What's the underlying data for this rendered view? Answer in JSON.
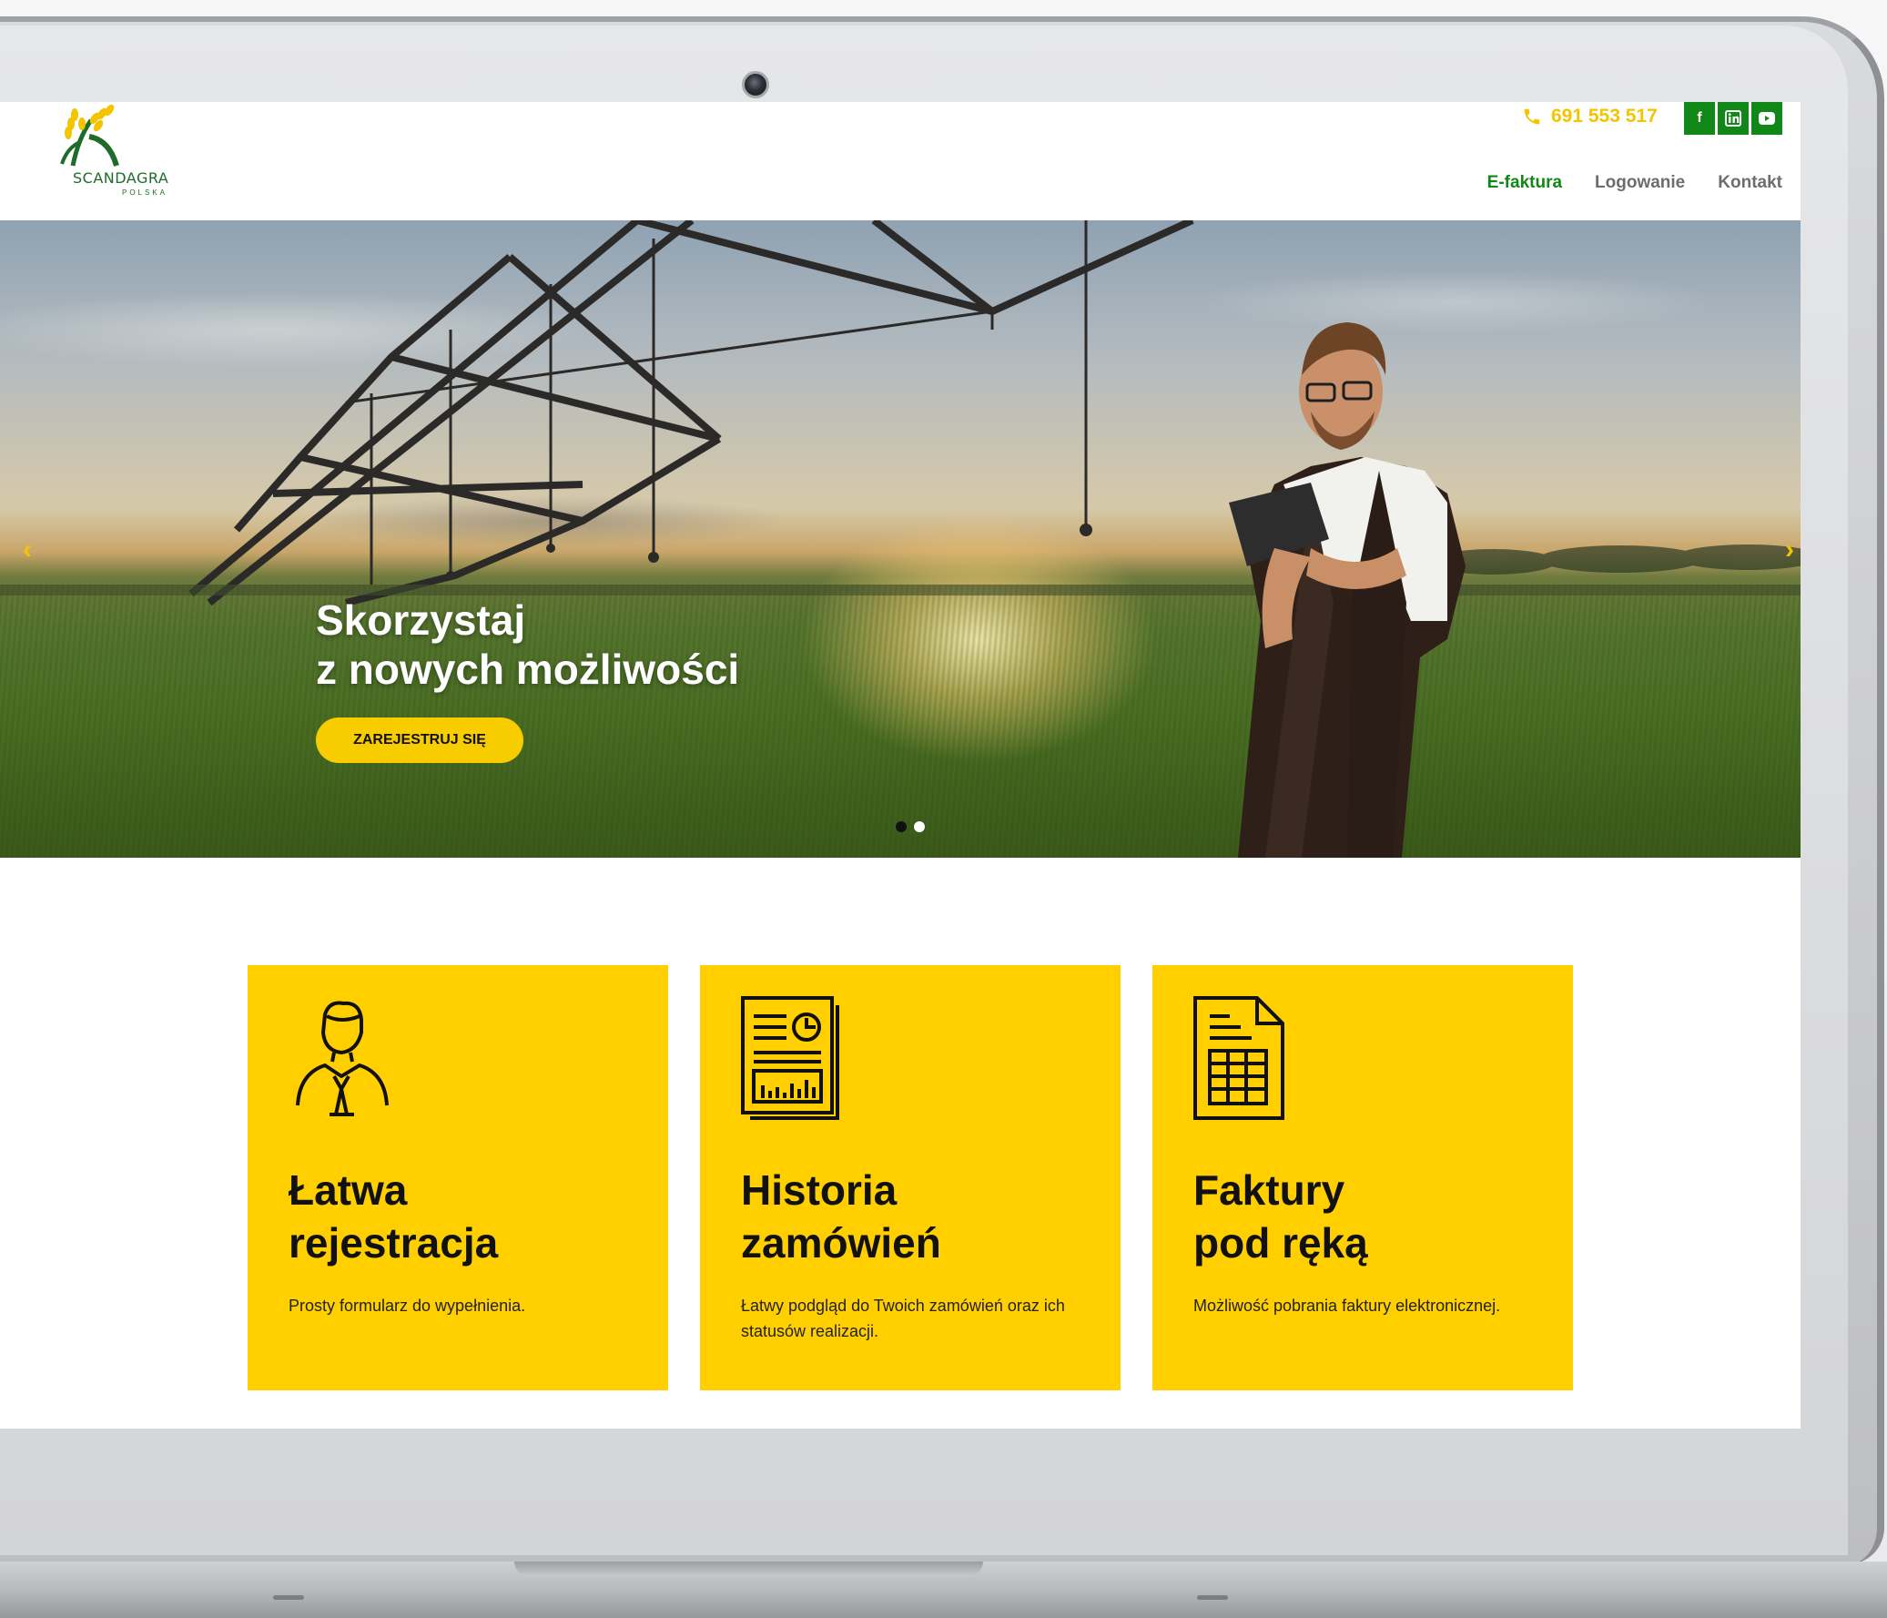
{
  "header": {
    "logo_text": "SCANDAGRA",
    "logo_subtext": "POLSKA",
    "phone": "691 553 517",
    "social": [
      {
        "icon": "facebook-icon",
        "glyph": "f"
      },
      {
        "icon": "linkedin-icon",
        "glyph": "in"
      },
      {
        "icon": "youtube-icon",
        "glyph": "▶"
      }
    ],
    "nav": [
      {
        "label": "E-faktura",
        "active": true
      },
      {
        "label": "Logowanie",
        "active": false
      },
      {
        "label": "Kontakt",
        "active": false
      }
    ]
  },
  "hero": {
    "title_line1": "Skorzystaj",
    "title_line2": "z nowych możliwości",
    "cta": "ZAREJESTRUJ SIĘ",
    "prev_arrow": "‹",
    "next_arrow": "›",
    "slides_count": 2,
    "active_slide": 1
  },
  "features": [
    {
      "icon": "user-icon",
      "title_line1": "Łatwa",
      "title_line2": "rejestracja",
      "text": "Prosty formularz do wypełnienia."
    },
    {
      "icon": "report-icon",
      "title_line1": "Historia",
      "title_line2": "zamówień",
      "text": "Łatwy podgląd do Twoich zamówień oraz ich statusów realizacji."
    },
    {
      "icon": "invoice-icon",
      "title_line1": "Faktury",
      "title_line2": "pod ręką",
      "text": "Możliwość pobrania faktury elektronicznej."
    }
  ],
  "colors": {
    "brand_green": "#108717",
    "brand_yellow": "#ffcf00",
    "phone_yellow": "#f2c500",
    "nav_gray": "#6d6d6d"
  }
}
